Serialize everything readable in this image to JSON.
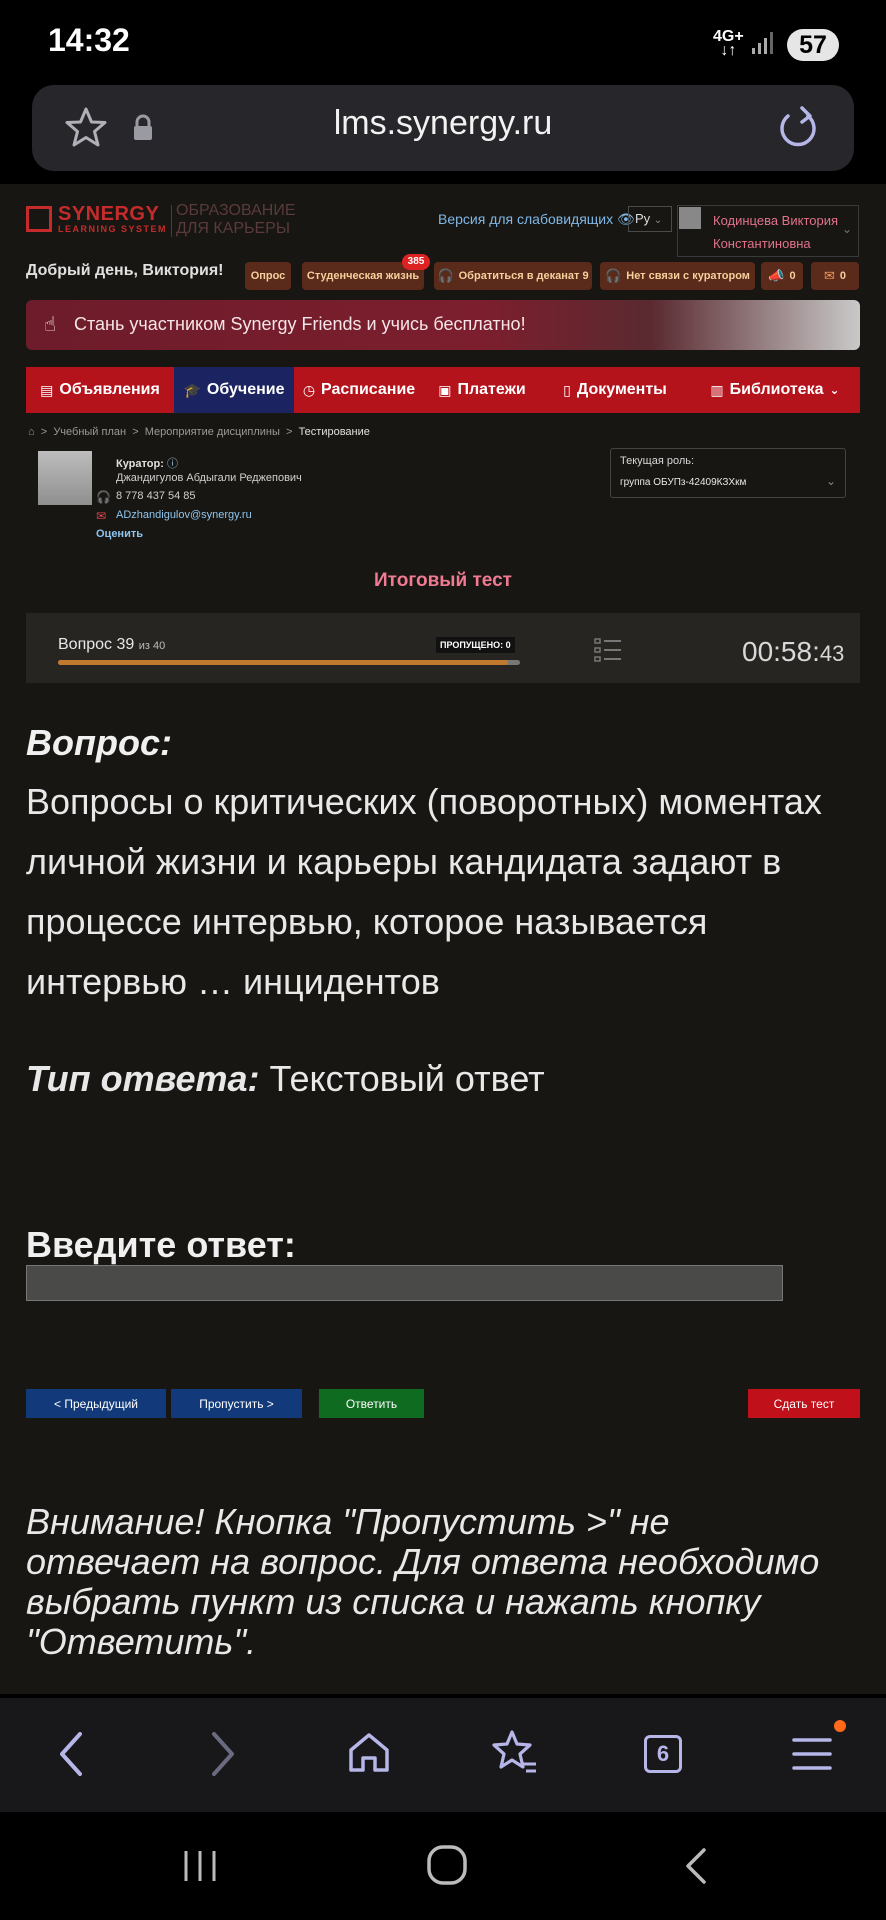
{
  "status": {
    "time": "14:32",
    "network": "4G+",
    "battery": "57"
  },
  "browser": {
    "url": "lms.synergy.ru",
    "tabs_count": "6"
  },
  "header": {
    "logo_name": "SYNERGY",
    "logo_sub": "LEARNING SYSTEM",
    "logo_tagline_1": "ОБРАЗОВАНИЕ",
    "logo_tagline_2": "ДЛЯ КАРЬЕРЫ",
    "vision_link": "Версия для слабовидящих",
    "lang": "Ру",
    "user_line1": "Кодинцева Виктория",
    "user_line2": "Константиновна",
    "greeting": "Добрый день, Виктория!"
  },
  "pills": {
    "survey": "Опрос",
    "student_life": "Студенческая жизнь",
    "student_life_badge": "385",
    "dean": "Обратиться в деканат 9",
    "curator": "Нет связи с куратором",
    "announce_count": "0",
    "mail_count": "0"
  },
  "banner": {
    "text": "Стань участником Synergy Friends и учись бесплатно!"
  },
  "nav": {
    "announcements": "Объявления",
    "learning": "Обучение",
    "schedule": "Расписание",
    "payments": "Платежи",
    "documents": "Документы",
    "library": "Библиотека"
  },
  "breadcrumb": {
    "item1": "Учебный план",
    "item2": "Мероприятие дисциплины",
    "current": "Тестирование"
  },
  "curator": {
    "label": "Куратор:",
    "name": "Джандигулов Абдыгали Реджепович",
    "phone": "8 778 437 54 85",
    "email": "ADzhandigulov@synergy.ru",
    "rate": "Оценить"
  },
  "role": {
    "label": "Текущая роль:",
    "value": "группа ОБУПз-42409КЗХкм"
  },
  "test": {
    "title": "Итоговый тест",
    "question_label": "Вопрос 39",
    "question_of": "из 40",
    "skipped": "ПРОПУЩЕНО: 0",
    "progress": 0.975,
    "timer_main": "00:58:",
    "timer_sec": "43"
  },
  "question": {
    "heading": "Вопрос:",
    "text": "Вопросы о критических (поворотных) моментах личной жизни и карьеры кандидата задают в процессе интервью, которое называется интервью … инцидентов",
    "type_label": "Тип ответа:",
    "type_value": "Текстовый ответ",
    "enter_label": "Введите ответ:",
    "answer_value": ""
  },
  "buttons": {
    "prev": "< Предыдущий",
    "skip": "Пропустить >",
    "answer": "Ответить",
    "submit": "Сдать тест"
  },
  "notice": "Внимание! Кнопка \"Пропустить >\" не отвечает на вопрос. Для ответа необходимо выбрать пункт из списка и нажать кнопку \"Ответить\"."
}
